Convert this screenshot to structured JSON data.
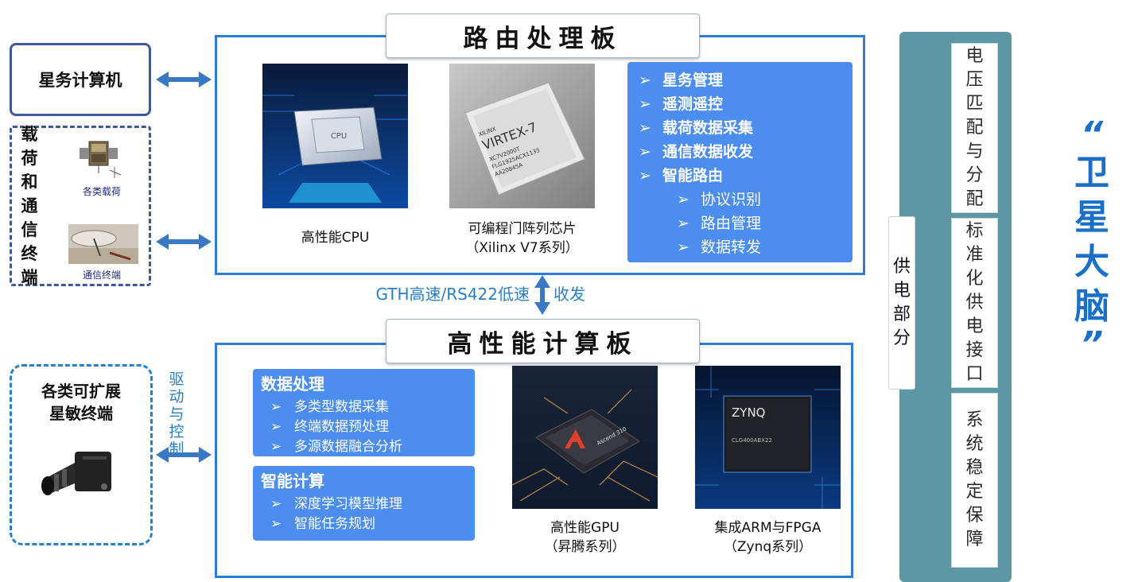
{
  "left": {
    "satellite_computer": "星务计算机",
    "payload_group_label": [
      "载",
      "荷",
      "和",
      "通",
      "信",
      "终",
      "端"
    ],
    "payload_label": "各类载荷",
    "comm_terminal_label": "通信终端",
    "sensor_terminal_label": "各类可扩展\n星敏终端",
    "sensor_line1": "各类可扩展",
    "sensor_line2": "星敏终端",
    "drive_control": [
      "驱",
      "动",
      "与",
      "控",
      "制"
    ]
  },
  "routing_board": {
    "title": "路由处理板",
    "cpu_caption": "高性能CPU",
    "fpga_caption_line1": "可编程门阵列芯片",
    "fpga_caption_line2": "（Xilinx V7系列）",
    "chip_text_cpu": "CPU",
    "chip_text_fpga_brand": "XILINX",
    "chip_text_fpga_name": "VIRTEX-7",
    "chip_text_fpga_lines": [
      "XC7V2000T",
      "FLG1925ACX1133",
      "AA20845A"
    ],
    "functions": [
      {
        "text": "星务管理",
        "level": 1
      },
      {
        "text": "遥测遥控",
        "level": 1
      },
      {
        "text": "载荷数据采集",
        "level": 1
      },
      {
        "text": "通信数据收发",
        "level": 1
      },
      {
        "text": "智能路由",
        "level": 1
      },
      {
        "text": "协议识别",
        "level": 2
      },
      {
        "text": "路由管理",
        "level": 2
      },
      {
        "text": "数据转发",
        "level": 2
      }
    ],
    "bullet": "➢"
  },
  "link": {
    "label_left": "GTH高速/RS422低速",
    "label_right": "收发"
  },
  "compute_board": {
    "title": "高性能计算板",
    "data_processing": {
      "head": "数据处理",
      "items": [
        "多类型数据采集",
        "终端数据预处理",
        "多源数据融合分析"
      ]
    },
    "intelligent_compute": {
      "head": "智能计算",
      "items": [
        "深度学习模型推理",
        "智能任务规划"
      ]
    },
    "gpu_caption_line1": "高性能GPU",
    "gpu_caption_line2": "（昇腾系列）",
    "gpu_chip_text": "Ascend 310",
    "soc_caption_line1": "集成ARM与FPGA",
    "soc_caption_line2": "（Zynq系列）",
    "soc_chip_text": "ZYNQ",
    "soc_chip_sub": "CLG400ABX22"
  },
  "power": {
    "side_label": [
      "供",
      "电",
      "部",
      "分"
    ],
    "cards": [
      [
        "电",
        "压",
        "匹",
        "配",
        "与",
        "分",
        "配"
      ],
      [
        "标",
        "准",
        "化",
        "供",
        "电",
        "接",
        "口"
      ],
      [
        "系",
        "统",
        "稳",
        "定",
        "保",
        "障"
      ]
    ]
  },
  "brain": {
    "open_quote": "“",
    "chars": [
      "卫",
      "星",
      "大",
      "脑"
    ],
    "close_quote": "”"
  },
  "colors": {
    "board_border": "#2d7dd2",
    "panel_blue": "#4b8ef0",
    "arrow_blue": "#3a78c3",
    "label_blue": "#2a7ec6",
    "power_teal": "#5d97a3",
    "brain_blue": "#1a6fc8"
  }
}
